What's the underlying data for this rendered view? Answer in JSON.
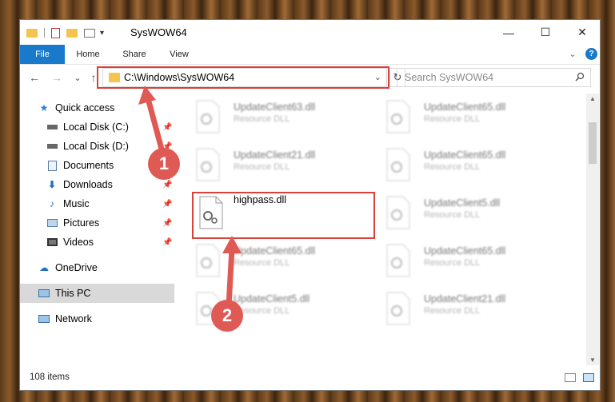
{
  "window": {
    "title": "SysWOW64",
    "minimize_glyph": "—",
    "maximize_glyph": "☐",
    "close_glyph": "✕"
  },
  "ribbon": {
    "tabs": [
      "File",
      "Home",
      "Share",
      "View"
    ],
    "collapse_glyph": "⌄",
    "help_glyph": "?"
  },
  "address": {
    "path": "C:\\Windows\\SysWOW64",
    "refresh_glyph": "↻",
    "search_placeholder": "Search SysWOW64"
  },
  "nav_glyphs": {
    "back": "←",
    "forward": "→",
    "recent": "⌄",
    "up": "↑"
  },
  "sidebar": {
    "items": [
      {
        "label": "Quick access",
        "icon": "star-icon",
        "pinned": false
      },
      {
        "label": "Local Disk (C:)",
        "icon": "drive-icon",
        "pinned": true
      },
      {
        "label": "Local Disk (D:)",
        "icon": "drive-icon",
        "pinned": true
      },
      {
        "label": "Documents",
        "icon": "documents-icon",
        "pinned": true
      },
      {
        "label": "Downloads",
        "icon": "downloads-icon",
        "pinned": true
      },
      {
        "label": "Music",
        "icon": "music-icon",
        "pinned": true
      },
      {
        "label": "Pictures",
        "icon": "pictures-icon",
        "pinned": true
      },
      {
        "label": "Videos",
        "icon": "videos-icon",
        "pinned": true
      },
      {
        "label": "OneDrive",
        "icon": "onedrive-icon",
        "pinned": false
      },
      {
        "label": "This PC",
        "icon": "computer-icon",
        "pinned": false,
        "selected": true
      },
      {
        "label": "Network",
        "icon": "network-icon",
        "pinned": false
      }
    ]
  },
  "files": [
    {
      "name": "UpdateClient63.dll",
      "type": "Resource DLL",
      "blurred": true
    },
    {
      "name": "UpdateClient65.dll",
      "type": "Resource DLL",
      "blurred": true
    },
    {
      "name": "UpdateClient21.dll",
      "type": "Resource DLL",
      "blurred": true
    },
    {
      "name": "UpdateClient65.dll",
      "type": "Resource DLL",
      "blurred": true
    },
    {
      "name": "highpass.dll",
      "type": "",
      "blurred": false
    },
    {
      "name": "UpdateClient5.dll",
      "type": "Resource DLL",
      "blurred": true
    },
    {
      "name": "UpdateClient65.dll",
      "type": "Resource DLL",
      "blurred": true
    },
    {
      "name": "UpdateClient65.dll",
      "type": "Resource DLL",
      "blurred": true
    },
    {
      "name": "UpdateClient5.dll",
      "type": "Resource DLL",
      "blurred": true
    },
    {
      "name": "UpdateClient21.dll",
      "type": "Resource DLL",
      "blurred": true
    }
  ],
  "status": {
    "item_count": "108 items"
  },
  "annotations": {
    "step1": "1",
    "step2": "2",
    "color": "#d9413b"
  },
  "colors": {
    "accent": "#1979ca",
    "highlight": "#d9413b",
    "folder": "#f4c44e"
  }
}
